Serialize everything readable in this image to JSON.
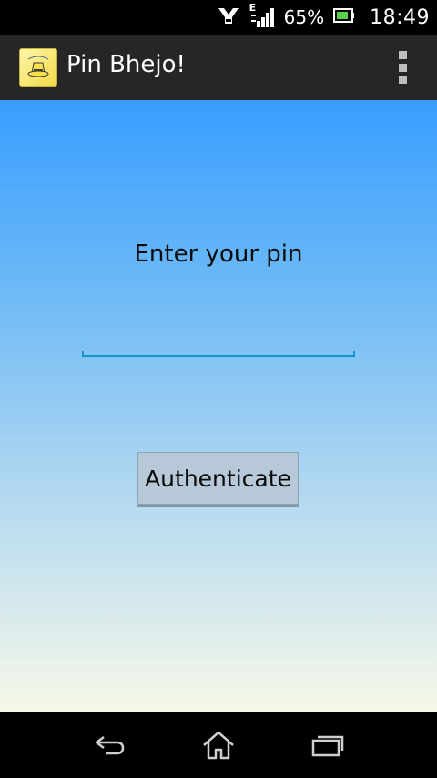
{
  "status_bar": {
    "network_type": "E",
    "battery_percent": "65%",
    "time": "18:49",
    "icons": [
      "notification-app-icon",
      "signal-icon",
      "battery-icon"
    ]
  },
  "action_bar": {
    "title": "Pin Bhejo!",
    "app_icon": "app-logo-icon",
    "overflow_icon": "overflow-menu-icon"
  },
  "main": {
    "prompt": "Enter your pin",
    "pin_value": "",
    "button_label": "Authenticate"
  },
  "nav_bar": {
    "icons": [
      "back-icon",
      "home-icon",
      "recent-apps-icon"
    ]
  },
  "colors": {
    "background_top": "#399eff",
    "background_bottom": "#f6f7e8",
    "accent_underline": "#1597c6",
    "button_bg": "#b7c9d8",
    "action_bar_bg": "#262626"
  }
}
